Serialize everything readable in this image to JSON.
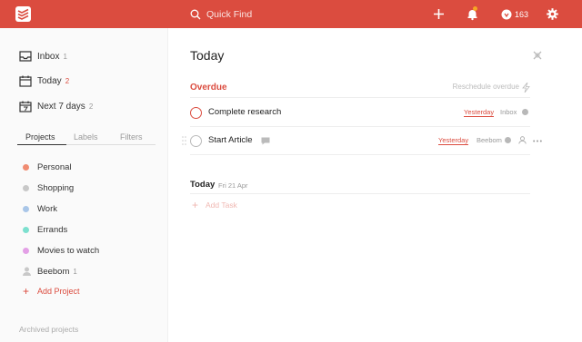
{
  "topbar": {
    "search_placeholder": "Quick Find",
    "karma_count": "163",
    "icons": [
      "todoist-logo-icon",
      "search-icon",
      "add-icon",
      "bell-icon",
      "karma-icon",
      "gear-icon"
    ],
    "accent": "#db4c3f"
  },
  "sidebar": {
    "nav": [
      {
        "label": "Inbox",
        "count": "1"
      },
      {
        "label": "Today",
        "count": "2"
      },
      {
        "label": "Next 7 days",
        "count": "2"
      }
    ],
    "tabs": [
      "Projects",
      "Labels",
      "Filters"
    ],
    "projects": [
      {
        "label": "Personal",
        "color": "#f08c72",
        "count": ""
      },
      {
        "label": "Shopping",
        "color": "#c8c8c8",
        "count": ""
      },
      {
        "label": "Work",
        "color": "#a9c6e8",
        "count": ""
      },
      {
        "label": "Errands",
        "color": "#7de0cf",
        "count": ""
      },
      {
        "label": "Movies to watch",
        "color": "#e3a0e6",
        "count": ""
      },
      {
        "label": "Beebom",
        "color": "#c8c8c8",
        "count": "1"
      }
    ],
    "add_project": "Add Project",
    "archived": "Archived projects"
  },
  "main": {
    "title": "Today",
    "overdue": {
      "label": "Overdue",
      "reschedule": "Reschedule overdue"
    },
    "tasks": [
      {
        "name": "Complete research",
        "date": "Yesterday",
        "project": "Inbox"
      },
      {
        "name": "Start Article",
        "date": "Yesterday",
        "project": "Beebom"
      }
    ],
    "today_section": {
      "label": "Today",
      "date": "Fri 21 Apr"
    },
    "add_task": "Add Task"
  }
}
